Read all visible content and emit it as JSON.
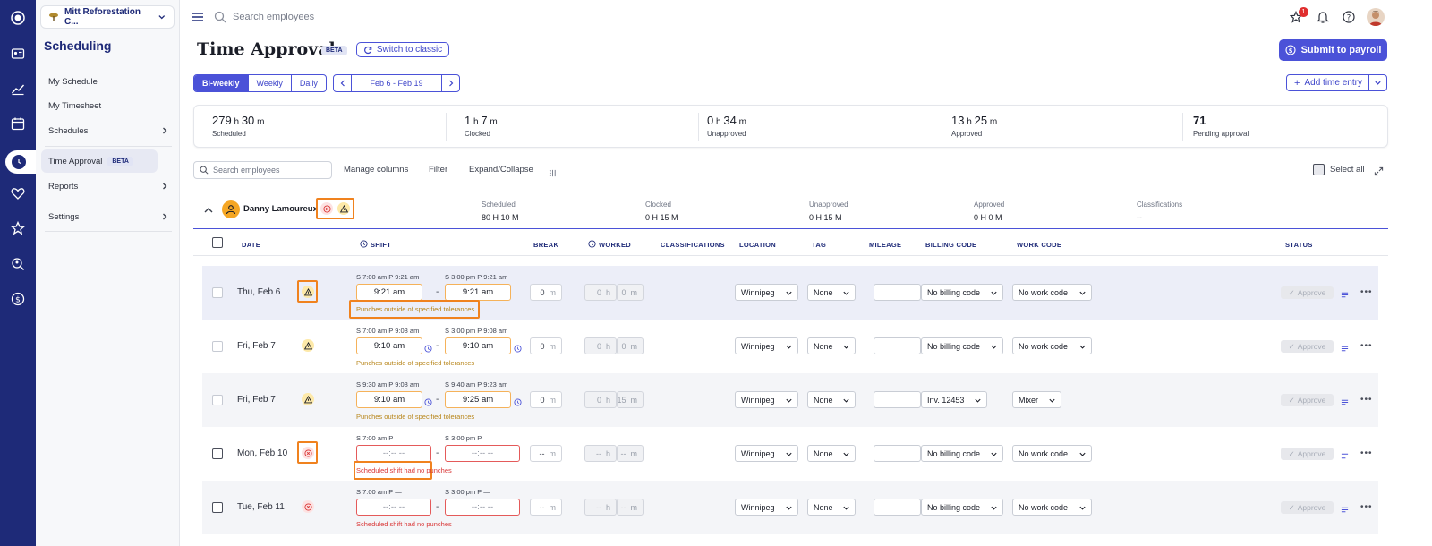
{
  "org": {
    "name": "Mitt Reforestation C..."
  },
  "sidebar": {
    "title": "Scheduling",
    "items": [
      {
        "label": "My Schedule"
      },
      {
        "label": "My Timesheet"
      },
      {
        "label": "Schedules"
      },
      {
        "label": "Time Approval",
        "badge": "BETA"
      },
      {
        "label": "Reports"
      },
      {
        "label": "Settings"
      }
    ]
  },
  "topbar": {
    "search_placeholder": "Search employees",
    "notif_count": "1"
  },
  "page": {
    "title": "Time Approval",
    "beta": "BETA",
    "switch_label": "Switch to classic",
    "submit_label": "Submit to payroll",
    "add_entry_label": "Add time entry",
    "periods": [
      "Bi-weekly",
      "Weekly",
      "Daily"
    ],
    "date_range": "Feb 6 - Feb 19"
  },
  "stats": [
    {
      "h": "279",
      "m": "30",
      "label": "Scheduled"
    },
    {
      "h": "1",
      "m": "7",
      "label": "Clocked"
    },
    {
      "h": "0",
      "m": "34",
      "label": "Unapproved"
    },
    {
      "h": "13",
      "m": "25",
      "label": "Approved"
    },
    {
      "value": "71",
      "label": "Pending approval"
    }
  ],
  "toolbar": {
    "search_placeholder": "Search employees",
    "manage_columns": "Manage columns",
    "filter": "Filter",
    "expand_collapse": "Expand/Collapse",
    "select_all": "Select all"
  },
  "employee": {
    "name": "Danny Lamoureux",
    "summary": [
      {
        "label": "Scheduled",
        "value": "80 H 10 M"
      },
      {
        "label": "Clocked",
        "value": "0 H 15 M"
      },
      {
        "label": "Unapproved",
        "value": "0 H 15 M"
      },
      {
        "label": "Approved",
        "value": "0 H 0 M"
      },
      {
        "label": "Classifications",
        "value": "--"
      }
    ]
  },
  "columns": [
    "DATE",
    "SHIFT",
    "BREAK",
    "WORKED",
    "CLASSIFICATIONS",
    "LOCATION",
    "TAG",
    "MILEAGE",
    "BILLING CODE",
    "WORK CODE",
    "STATUS"
  ],
  "rows": [
    {
      "date": "Thu, Feb 6",
      "s_in": "S 7:00 am  P 9:21 am",
      "s_out": "S 3:00 pm  P 9:21 am",
      "t_in": "9:21 am",
      "t_out": "9:21 am",
      "break": "0",
      "wh": "0",
      "wm": "0",
      "loc": "Winnipeg",
      "tag": "None",
      "billing": "No billing code",
      "work": "No work code",
      "msg": "Punches outside of specified tolerances",
      "approve": "Approve"
    },
    {
      "date": "Fri, Feb 7",
      "s_in": "S 7:00 am  P 9:08 am",
      "s_out": "S 3:00 pm  P 9:08 am",
      "t_in": "9:10 am",
      "t_out": "9:10 am",
      "break": "0",
      "wh": "0",
      "wm": "0",
      "loc": "Winnipeg",
      "tag": "None",
      "billing": "No billing code",
      "work": "No work code",
      "msg": "Punches outside of specified tolerances",
      "approve": "Approve"
    },
    {
      "date": "Fri, Feb 7",
      "s_in": "S 9:30 am  P 9:08 am",
      "s_out": "S 9:40 am  P 9:23 am",
      "t_in": "9:10 am",
      "t_out": "9:25 am",
      "break": "0",
      "wh": "0",
      "wm": "15",
      "loc": "Winnipeg",
      "tag": "None",
      "billing": "Inv. 12453",
      "work": "Mixer",
      "msg": "Punches outside of specified tolerances",
      "approve": "Approve"
    },
    {
      "date": "Mon, Feb 10",
      "s_in": "S 7:00 am  P —",
      "s_out": "S 3:00 pm  P —",
      "t_in": "--:-- --",
      "t_out": "--:-- --",
      "break": "--",
      "wh": "--",
      "wm": "--",
      "loc": "Winnipeg",
      "tag": "None",
      "billing": "No billing code",
      "work": "No work code",
      "msg": "Scheduled shift had no punches",
      "approve": "Approve"
    },
    {
      "date": "Tue, Feb 11",
      "s_in": "S 7:00 am  P —",
      "s_out": "S 3:00 pm  P —",
      "t_in": "--:-- --",
      "t_out": "--:-- --",
      "break": "--",
      "wh": "--",
      "wm": "--",
      "loc": "Winnipeg",
      "tag": "None",
      "billing": "No billing code",
      "work": "No work code",
      "msg": "Scheduled shift had no punches",
      "approve": "Approve"
    }
  ],
  "units": {
    "m": "m",
    "h": "h"
  }
}
